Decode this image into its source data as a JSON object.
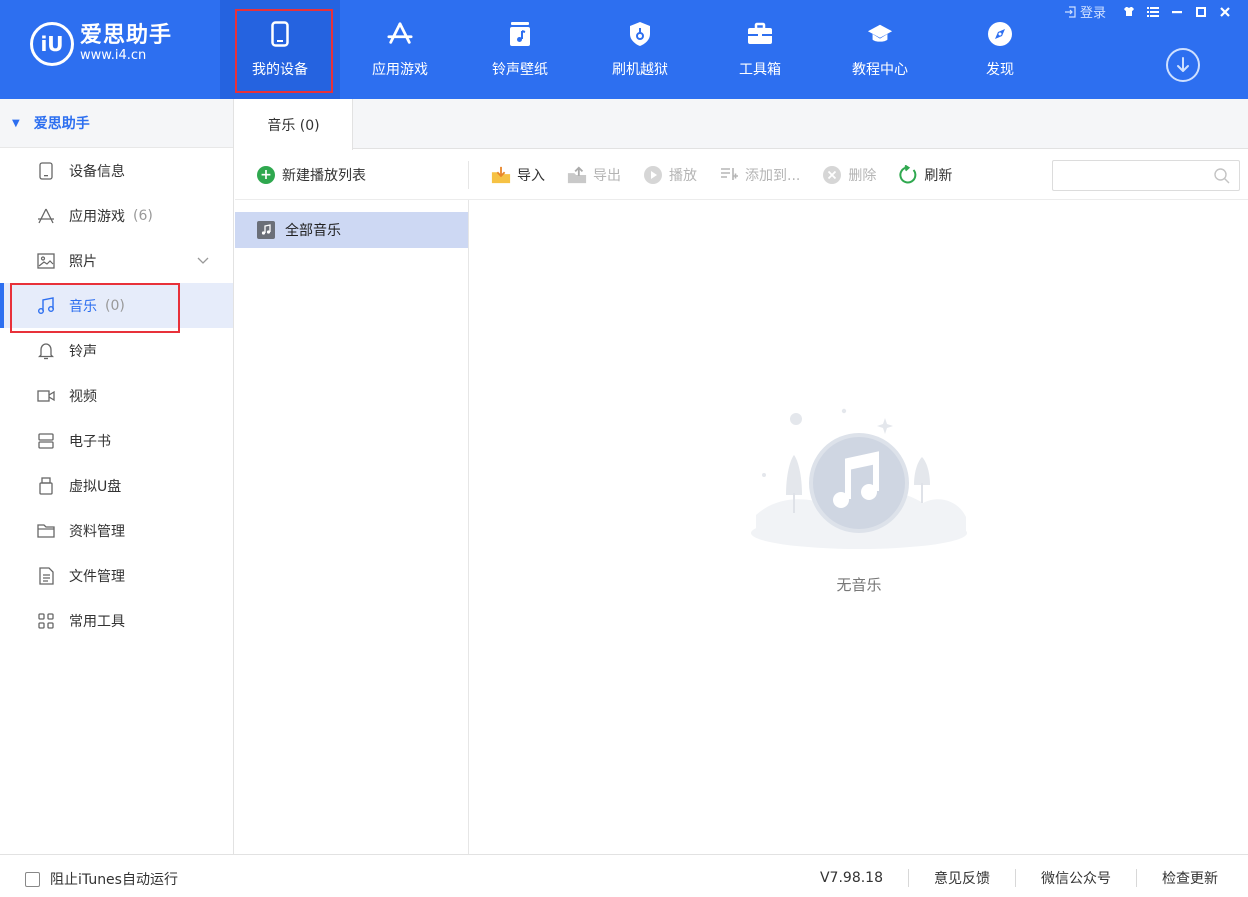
{
  "app": {
    "logo_mark": "iU",
    "name": "爱思助手",
    "url": "www.i4.cn"
  },
  "nav": [
    {
      "label": "我的设备",
      "icon": "phone-icon"
    },
    {
      "label": "应用游戏",
      "icon": "app-store-icon"
    },
    {
      "label": "铃声壁纸",
      "icon": "music-note-icon"
    },
    {
      "label": "刷机越狱",
      "icon": "shield-key-icon"
    },
    {
      "label": "工具箱",
      "icon": "toolbox-icon"
    },
    {
      "label": "教程中心",
      "icon": "graduation-cap-icon"
    },
    {
      "label": "发现",
      "icon": "compass-icon"
    }
  ],
  "window": {
    "login_label": "登录"
  },
  "sidebar": {
    "title": "爱思助手",
    "items": [
      {
        "label": "设备信息",
        "icon": "device-info-icon"
      },
      {
        "label": "应用游戏",
        "count": "(6)",
        "icon": "app-icon"
      },
      {
        "label": "照片",
        "icon": "photo-icon"
      },
      {
        "label": "音乐",
        "count": "(0)",
        "icon": "music-icon"
      },
      {
        "label": "铃声",
        "icon": "bell-icon"
      },
      {
        "label": "视频",
        "icon": "video-icon"
      },
      {
        "label": "电子书",
        "icon": "book-icon"
      },
      {
        "label": "虚拟U盘",
        "icon": "usb-drive-icon"
      },
      {
        "label": "资料管理",
        "icon": "folder-icon"
      },
      {
        "label": "文件管理",
        "icon": "file-icon"
      },
      {
        "label": "常用工具",
        "icon": "grid-icon"
      }
    ]
  },
  "tabs": [
    {
      "label": "音乐 (0)"
    }
  ],
  "toolbar": {
    "new_playlist": "新建播放列表",
    "import": "导入",
    "export": "导出",
    "play": "播放",
    "add_to": "添加到...",
    "delete": "删除",
    "refresh": "刷新",
    "search_placeholder": ""
  },
  "playlist": {
    "all_music": "全部音乐"
  },
  "empty": {
    "text": "无音乐"
  },
  "footer": {
    "itunes_label": "阻止iTunes自动运行",
    "version": "V7.98.18",
    "feedback": "意见反馈",
    "wechat": "微信公众号",
    "check_update": "检查更新"
  },
  "colors": {
    "header_bg": "#2d6ff0",
    "accent": "#2d6ff0",
    "highlight_border": "#e8313a",
    "selected_row": "#cdd8f3"
  }
}
